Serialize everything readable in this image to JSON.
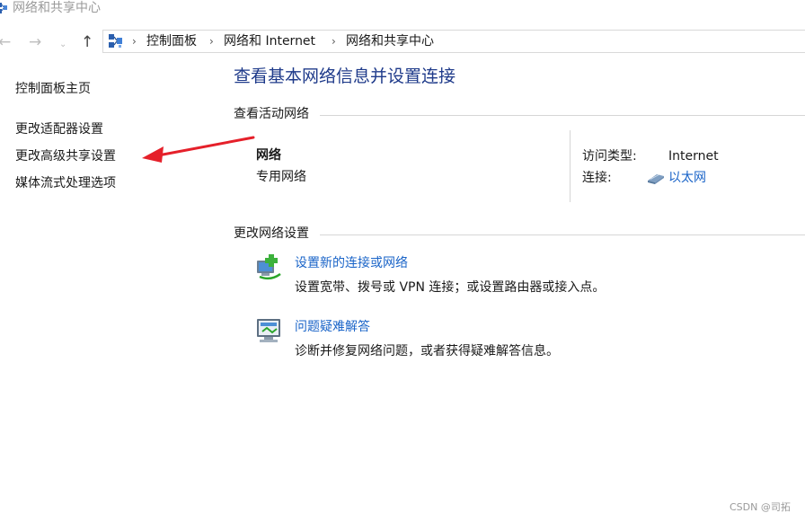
{
  "window": {
    "title": "网络和共享中心"
  },
  "nav": {
    "back_glyph": "←",
    "forward_glyph": "→",
    "recent_glyph": "⌄",
    "up_glyph": "↑"
  },
  "breadcrumb": {
    "separator": "›",
    "items": [
      "控制面板",
      "网络和 Internet",
      "网络和共享中心"
    ]
  },
  "left_pane": {
    "home": "控制面板主页",
    "links": [
      "更改适配器设置",
      "更改高级共享设置",
      "媒体流式处理选项"
    ]
  },
  "main": {
    "title": "查看基本网络信息并设置连接",
    "active_section": "查看活动网络",
    "network": {
      "name": "网络",
      "type": "专用网络",
      "access_label": "访问类型:",
      "access_value": "Internet",
      "connection_label": "连接:",
      "connection_value": "以太网"
    },
    "change_section": "更改网络设置",
    "tasks": [
      {
        "title": "设置新的连接或网络",
        "desc": "设置宽带、拨号或 VPN 连接；或设置路由器或接入点。"
      },
      {
        "title": "问题疑难解答",
        "desc": "诊断并修复网络问题，或者获得疑难解答信息。"
      }
    ]
  },
  "watermark": "CSDN @司拓",
  "colors": {
    "link": "#1a64c8",
    "title": "#1e3a8a",
    "arrow": "#e5202a"
  },
  "icons": {
    "title": "network-center-icon",
    "address": "control-panel-icon",
    "connection": "ethernet-icon",
    "setup": "new-connection-icon",
    "troubleshoot": "troubleshoot-icon"
  }
}
